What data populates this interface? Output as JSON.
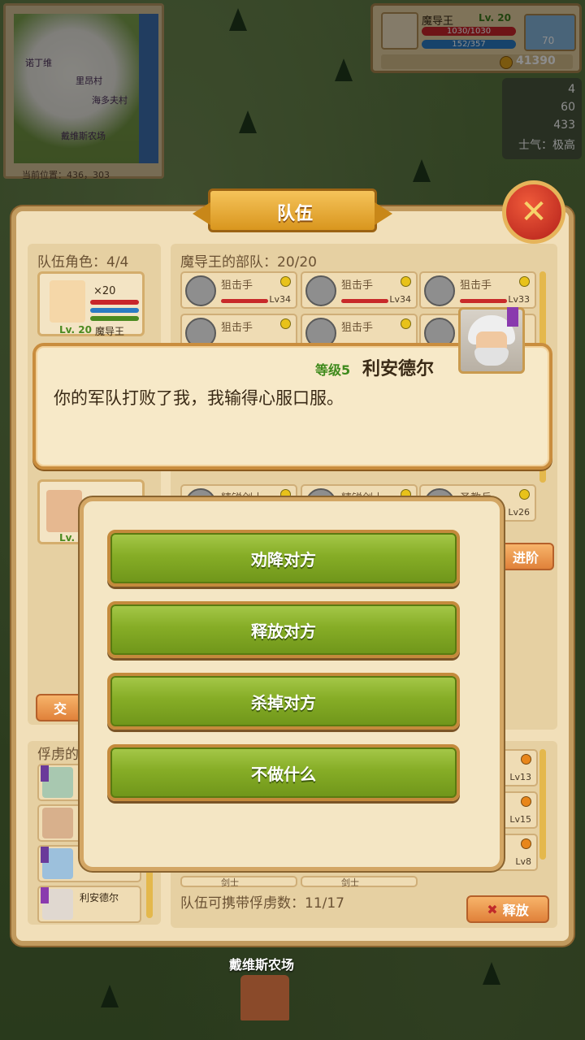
{
  "map": {
    "minimap_labels": [
      "诺丁维",
      "里昂村",
      "海多夫村",
      "戴维斯农场"
    ],
    "current_position": "当前位置：436，303",
    "village_name": "戴维斯农场"
  },
  "player": {
    "name": "魔导王",
    "level": "Lv. 20",
    "hp": "1030/1030",
    "mp": "152/357",
    "weather_value": "70",
    "gold": "41390"
  },
  "resources": {
    "r1": "4",
    "r2": "60",
    "r3": "433",
    "morale": "士气：极高"
  },
  "window": {
    "title": "队伍",
    "team_roles_label": "队伍角色：4/4",
    "army_label": "魔导王的部队：20/20",
    "hero1": {
      "count": "×20",
      "level": "Lv. 20",
      "name": "魔导王"
    },
    "hero2": {
      "level": "Lv."
    },
    "units_row1": [
      {
        "name": "狙击手",
        "lv": "Lv34"
      },
      {
        "name": "狙击手",
        "lv": "Lv34"
      },
      {
        "name": "狙击手",
        "lv": "Lv33"
      }
    ],
    "units_row2": [
      {
        "name": "狙击手",
        "lv": ""
      },
      {
        "name": "狙击手",
        "lv": ""
      },
      {
        "name": "狙",
        "lv": ""
      }
    ],
    "units_row5": [
      {
        "name": "精锐剑士",
        "lv": ""
      },
      {
        "name": "精锐剑士",
        "lv": ""
      },
      {
        "name": "圣教兵",
        "lv": "Lv26"
      }
    ],
    "advance_button": "进阶",
    "chat_button": "交",
    "prisoner_label": "俘虏的",
    "prisoner_lvs": [
      "Lv13",
      "Lv15",
      "Lv8"
    ],
    "prisoner_name": "利安德尔",
    "bottom_units": [
      "剑士",
      "剑士"
    ],
    "carry_text": "队伍可携带俘虏数：11/17",
    "release_button": "释放"
  },
  "dialog": {
    "level": "等级5",
    "name": "利安德尔",
    "text": "你的军队打败了我，我输得心服口服。"
  },
  "choices": {
    "persuade": "劝降对方",
    "release": "释放对方",
    "kill": "杀掉对方",
    "nothing": "不做什么"
  },
  "colors": {
    "choice_green": "#86ad26",
    "close_red": "#b3201a",
    "level_green": "#3f8a1c"
  }
}
